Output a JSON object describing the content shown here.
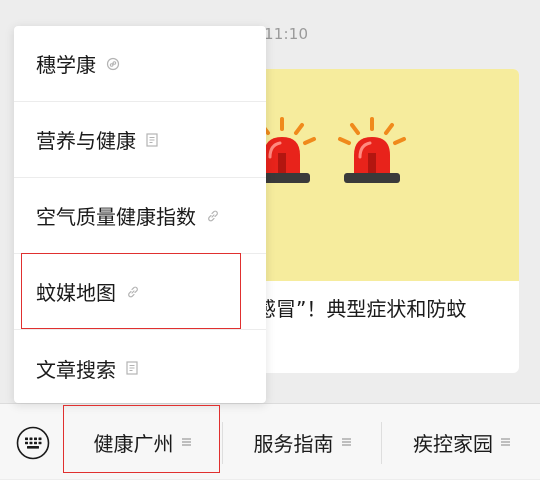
{
  "chat": {
    "timestamp": "11:10",
    "article": {
      "title": "感冒”！典型症状和防蚊"
    }
  },
  "popup_menu": {
    "items": [
      {
        "label": "穗学康",
        "icon": "miniprogram-icon"
      },
      {
        "label": "营养与健康",
        "icon": "article-icon"
      },
      {
        "label": "空气质量健康指数",
        "icon": "link-icon"
      },
      {
        "label": "蚊媒地图",
        "icon": "link-icon",
        "highlighted": true
      },
      {
        "label": "文章搜索",
        "icon": "article-icon"
      }
    ]
  },
  "bottom_menu": {
    "keyboard_icon": "keyboard-icon",
    "tabs": [
      {
        "label": "健康广州",
        "icon": "menu-lines-icon",
        "highlighted": true
      },
      {
        "label": "服务指南",
        "icon": "menu-lines-icon"
      },
      {
        "label": "疾控家园",
        "icon": "menu-lines-icon"
      }
    ]
  },
  "colors": {
    "page_background": "#ededed",
    "cover_background": "#f6ec9d",
    "highlight": "#e0302f",
    "siren_red": "#e8231b",
    "siren_base": "#3a3a3a",
    "icon_gray": "#b3b3b3"
  }
}
